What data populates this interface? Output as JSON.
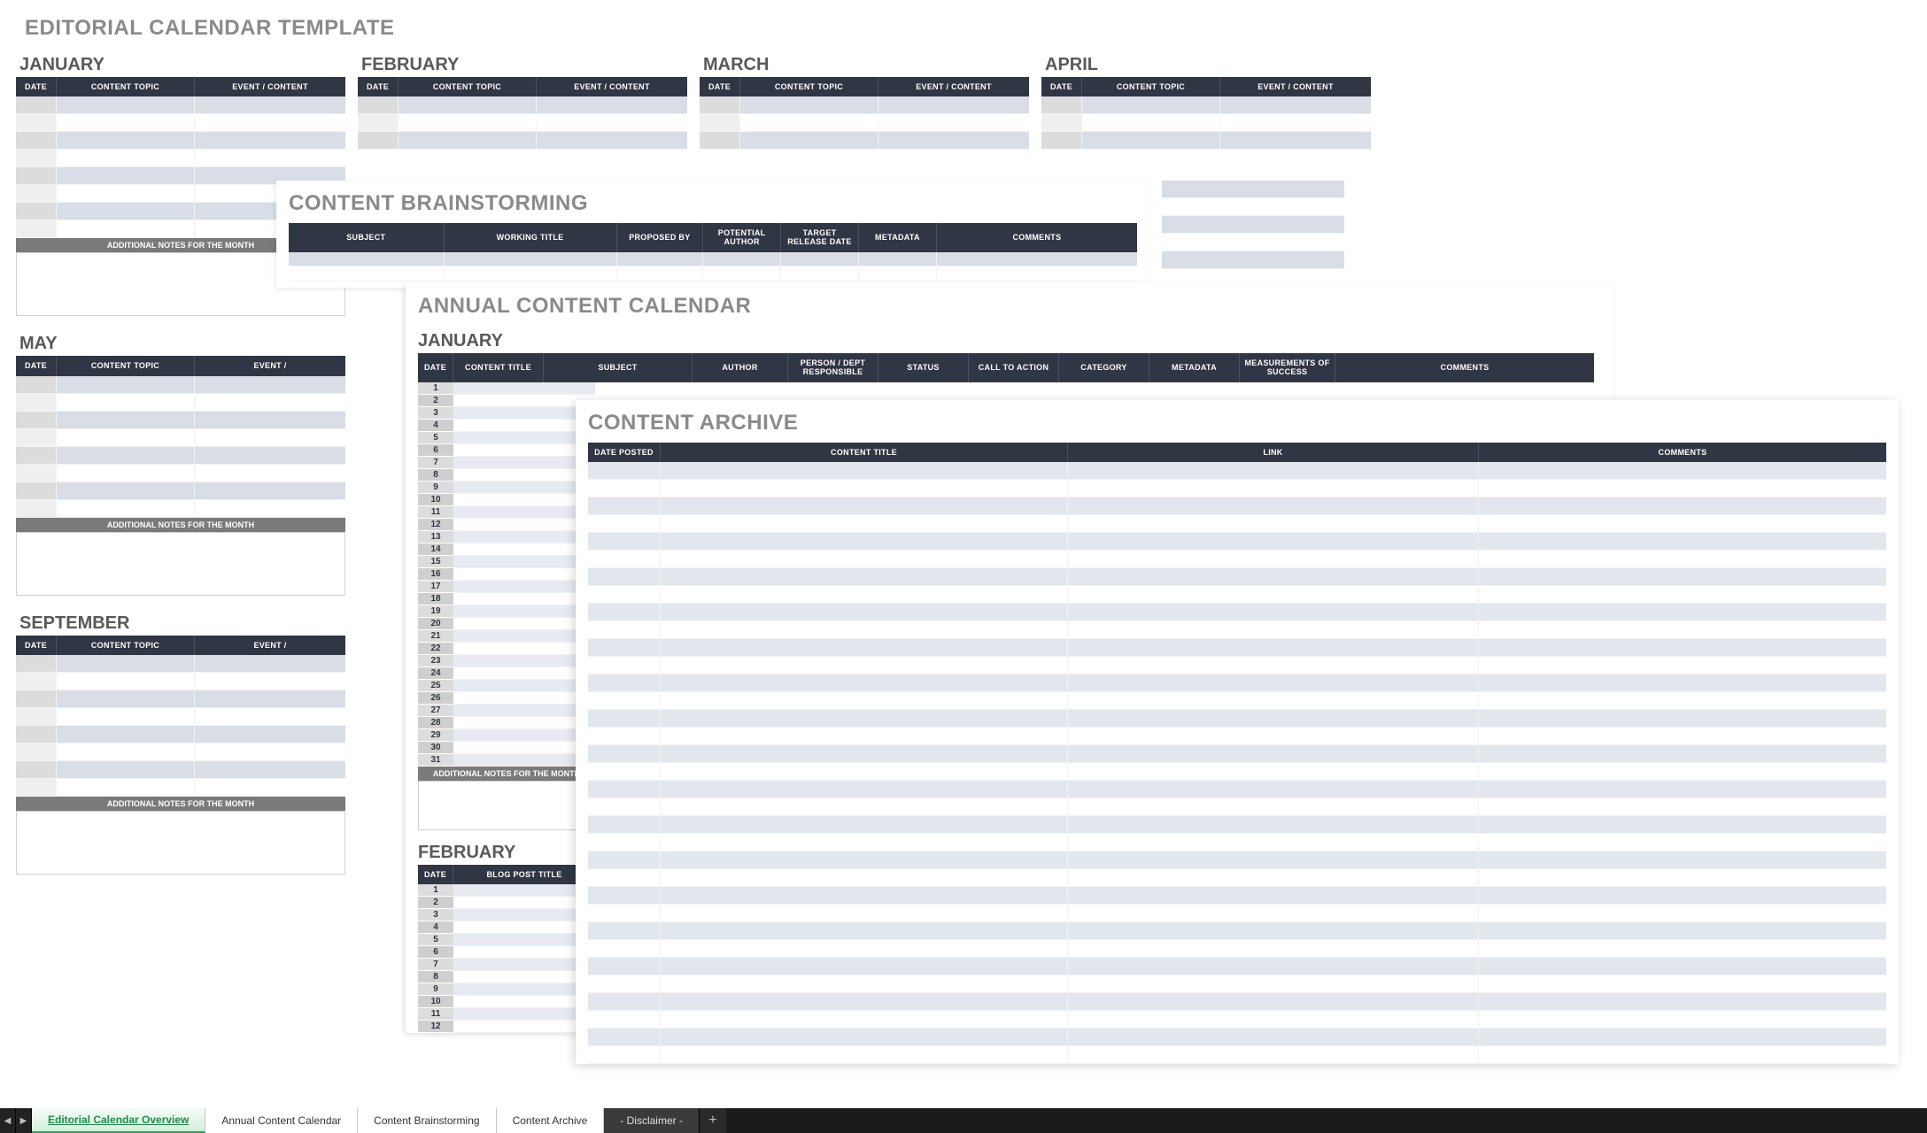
{
  "editorial": {
    "pageTitle": "EDITORIAL CALENDAR TEMPLATE",
    "headers": {
      "date": "DATE",
      "topic": "CONTENT TOPIC",
      "event": "EVENT / CONTENT"
    },
    "notesLabel": "ADDITIONAL NOTES FOR THE MONTH",
    "monthsRow1": [
      "JANUARY",
      "FEBRUARY",
      "MARCH",
      "APRIL"
    ],
    "monthsRow2": [
      "MAY"
    ],
    "monthsRow3": [
      "SEPTEMBER"
    ]
  },
  "brainstorm": {
    "title": "CONTENT BRAINSTORMING",
    "headers": {
      "subject": "SUBJECT",
      "workingTitle": "WORKING TITLE",
      "proposedBy": "PROPOSED BY",
      "potentialAuthor": "POTENTIAL AUTHOR",
      "targetRelease": "TARGET RELEASE DATE",
      "metadata": "METADATA",
      "comments": "COMMENTS"
    }
  },
  "annual": {
    "title": "ANNUAL CONTENT CALENDAR",
    "month1": "JANUARY",
    "month2": "FEBRUARY",
    "notesLabel": "ADDITIONAL NOTES FOR THE MONTH",
    "headers": {
      "date": "DATE",
      "contentTitle": "CONTENT TITLE",
      "subject": "SUBJECT",
      "author": "AUTHOR",
      "responsible": "PERSON / DEPT RESPONSIBLE",
      "status": "STATUS",
      "cta": "CALL TO ACTION",
      "category": "CATEGORY",
      "metadata": "METADATA",
      "measurements": "MEASUREMENTS OF SUCCESS",
      "comments": "COMMENTS"
    },
    "febHeaders": {
      "date": "DATE",
      "blogPostTitle": "BLOG POST TITLE"
    },
    "days": 31
  },
  "archive": {
    "title": "CONTENT ARCHIVE",
    "headers": {
      "datePosted": "DATE POSTED",
      "contentTitle": "CONTENT TITLE",
      "link": "LINK",
      "comments": "COMMENTS"
    },
    "rows": 34
  },
  "tabs": {
    "overview": "Editorial Calendar Overview",
    "annual": "Annual Content Calendar",
    "brainstorm": "Content Brainstorming",
    "archive": "Content Archive",
    "disclaimer": "- Disclaimer -"
  }
}
